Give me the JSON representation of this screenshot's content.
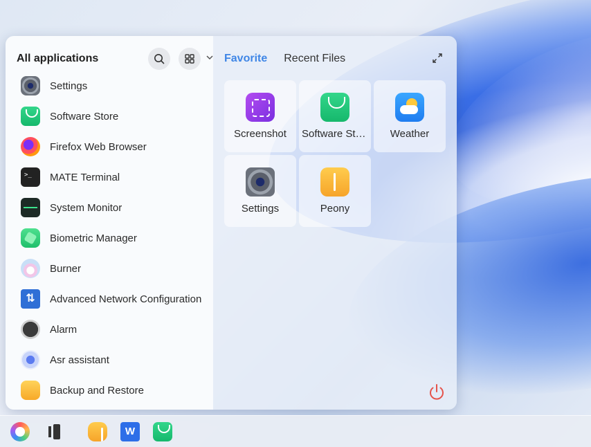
{
  "left_panel": {
    "title": "All applications",
    "apps": [
      {
        "label": "Settings",
        "icon": "settings-icon"
      },
      {
        "label": "Software Store",
        "icon": "software-store-icon"
      },
      {
        "label": "Firefox Web Browser",
        "icon": "firefox-icon"
      },
      {
        "label": "MATE Terminal",
        "icon": "terminal-icon"
      },
      {
        "label": "System Monitor",
        "icon": "system-monitor-icon"
      },
      {
        "label": "Biometric Manager",
        "icon": "biometric-icon"
      },
      {
        "label": "Burner",
        "icon": "burner-icon"
      },
      {
        "label": "Advanced Network Configuration",
        "icon": "network-icon"
      },
      {
        "label": "Alarm",
        "icon": "alarm-icon"
      },
      {
        "label": "Asr assistant",
        "icon": "asr-icon"
      },
      {
        "label": "Backup and Restore",
        "icon": "backup-icon"
      }
    ],
    "terminal_glyph": ">_",
    "network_glyph": "⇅"
  },
  "right_panel": {
    "tabs": [
      {
        "label": "Favorite",
        "active": true
      },
      {
        "label": "Recent Files",
        "active": false
      }
    ],
    "favorites": [
      {
        "label": "Screenshot",
        "icon": "screenshot-icon"
      },
      {
        "label": "Software Store",
        "icon": "software-store-icon"
      },
      {
        "label": "Weather",
        "icon": "weather-icon"
      },
      {
        "label": "Settings",
        "icon": "settings-icon"
      },
      {
        "label": "Peony",
        "icon": "peony-icon"
      }
    ]
  },
  "taskbar": {
    "items": [
      "start-menu-icon",
      "multitask-icon",
      "peony-icon",
      "wps-icon",
      "software-store-icon"
    ],
    "wps_glyph": "W"
  },
  "colors": {
    "accent": "#3f86e6",
    "power": "#e5534b"
  }
}
